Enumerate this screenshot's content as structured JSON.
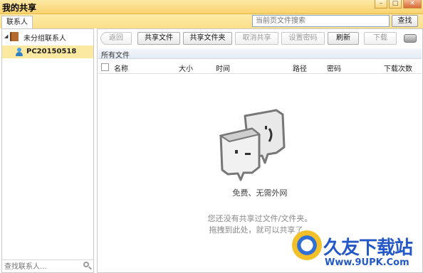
{
  "window": {
    "title": "我的共享"
  },
  "search": {
    "placeholder": "当前页文件搜索",
    "button_label": "查找"
  },
  "tabs": {
    "contacts": "联系人"
  },
  "sidebar": {
    "group_label": "未分组联系人",
    "contacts": [
      {
        "name": "PC20150518"
      }
    ],
    "search_placeholder": "查找联系人..."
  },
  "toolbar": {
    "back": "返回",
    "share_file": "共享文件",
    "share_folder": "共享文件夹",
    "cancel_share": "取消共享",
    "set_password": "设置密码",
    "refresh": "刷新",
    "download": "下载"
  },
  "folder_bar": {
    "label": "所有文件"
  },
  "columns": {
    "name": "名称",
    "size": "大小",
    "time": "时间",
    "path": "路径",
    "password": "密码",
    "downloads": "下载次数"
  },
  "empty_state": {
    "title": "免费、无需外网",
    "line1": "您还没有共享过文件/文件夹。",
    "line2": "拖拽到此处，就可以共享了。"
  },
  "watermark": {
    "brand": "久友下载站",
    "url": "Www.9UPK.Com"
  },
  "colors": {
    "title_bar": "#fbd978",
    "selection": "#fbe9a1",
    "watermark": "#2458c6"
  }
}
